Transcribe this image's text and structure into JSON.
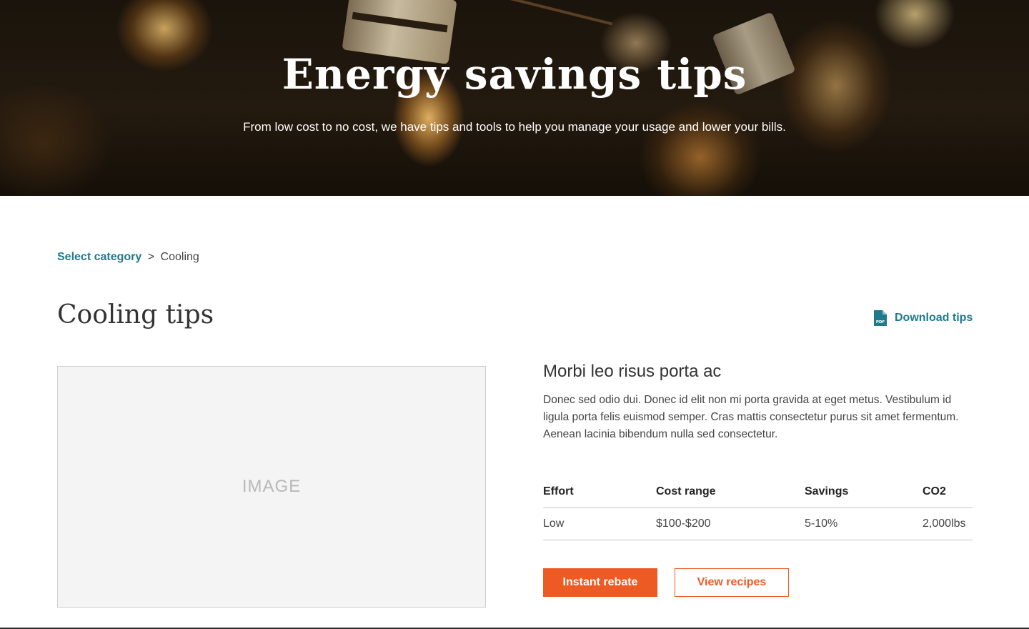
{
  "hero": {
    "title": "Energy savings tips",
    "subtitle": "From low cost to no cost, we have tips and tools to help you manage your usage and lower your bills."
  },
  "breadcrumb": {
    "link_label": "Select category",
    "separator": ">",
    "current": "Cooling"
  },
  "page": {
    "title": "Cooling tips"
  },
  "download": {
    "label": "Download tips",
    "icon": "pdf-file-icon",
    "icon_text": "PDF"
  },
  "image_placeholder": {
    "label": "IMAGE"
  },
  "tip": {
    "heading": "Morbi leo risus porta ac",
    "body": "Donec sed odio dui. Donec id elit non mi porta gravida at eget metus. Vestibulum id ligula porta felis euismod semper. Cras mattis consectetur purus sit amet fermentum. Aenean lacinia bibendum nulla sed consectetur.",
    "table": {
      "headers": [
        "Effort",
        "Cost range",
        "Savings",
        "CO2"
      ],
      "row": [
        "Low",
        "$100-$200",
        "5-10%",
        "2,000lbs"
      ]
    }
  },
  "buttons": {
    "primary_label": "Instant rebate",
    "secondary_label": "View recipes"
  },
  "colors": {
    "accent_teal": "#1f7a8c",
    "accent_orange": "#ee5a24"
  }
}
